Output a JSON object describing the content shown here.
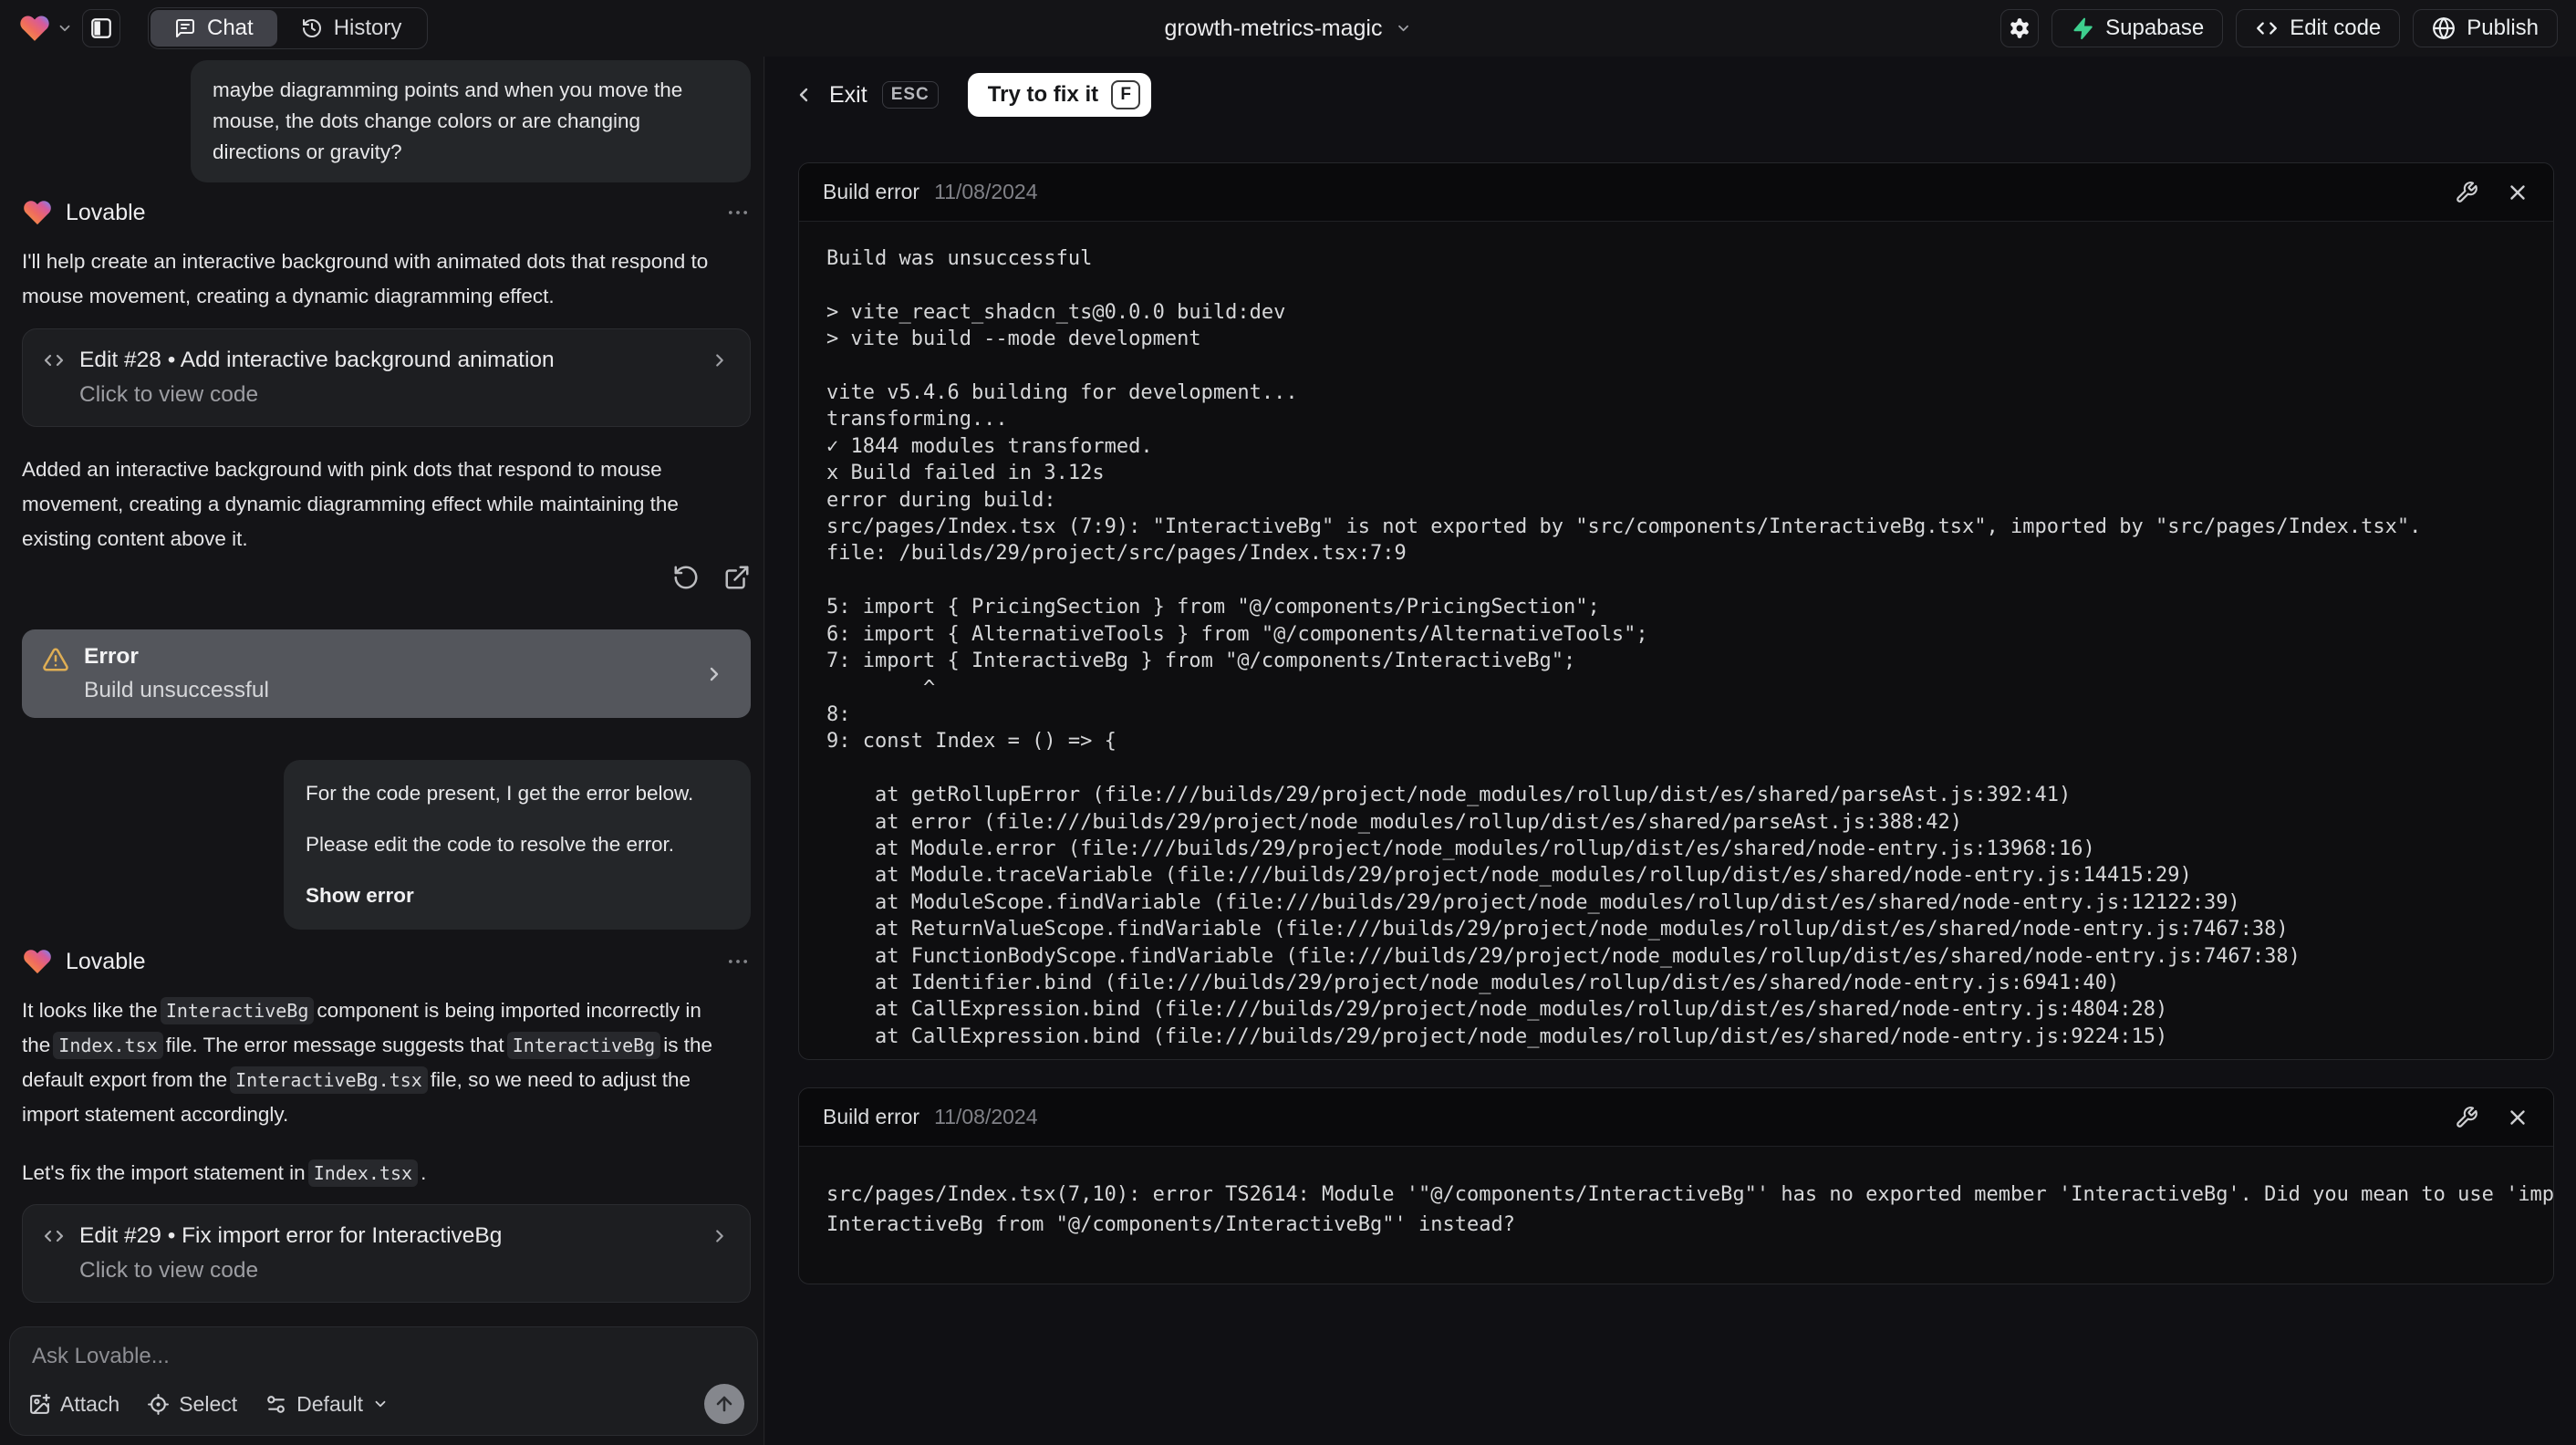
{
  "topbar": {
    "project_name": "growth-metrics-magic",
    "tab_chat": "Chat",
    "tab_history": "History",
    "supabase_label": "Supabase",
    "edit_code_label": "Edit code",
    "publish_label": "Publish"
  },
  "icons": {
    "logo": "lovable-heart-icon",
    "accent_green": "#3ecf8e",
    "warning_color": "#dfae54"
  },
  "chat": {
    "sender": "Lovable",
    "user_msg1": "maybe diagramming points and when you move the mouse, the dots change colors or are changing directions or gravity?",
    "assistant1": {
      "intro": "I'll help create an interactive background with animated dots that respond to mouse movement, creating a dynamic diagramming effect.",
      "edit_card": {
        "title": "Edit #28 • Add interactive background animation",
        "subtitle": "Click to view code"
      },
      "summary": "Added an interactive background with pink dots that respond to mouse movement, creating a dynamic diagramming effect while maintaining the existing content above it.",
      "error_card": {
        "title": "Error",
        "subtitle": "Build unsuccessful"
      }
    },
    "user_msg2": {
      "line1": "For the code present, I get the error below.",
      "line2": "Please edit the code to resolve the error.",
      "action": "Show error"
    },
    "assistant2": {
      "p1": [
        "It looks like the",
        "InteractiveBg",
        "component is being imported incorrectly in the",
        "Index.tsx",
        "file. The error message suggests that",
        "InteractiveBg",
        "is the default export from the",
        "InteractiveBg.tsx",
        "file, so we need to adjust the import statement accordingly."
      ],
      "p2": [
        "Let's fix the import statement in",
        "Index.tsx",
        "."
      ],
      "edit_card": {
        "title": "Edit #29 • Fix import error for InteractiveBg",
        "subtitle": "Click to view code"
      }
    },
    "composer": {
      "placeholder": "Ask Lovable...",
      "attach": "Attach",
      "select": "Select",
      "mode": "Default"
    }
  },
  "error_panel": {
    "exit_label": "Exit",
    "esc_key": "ESC",
    "fix_label": "Try to fix it",
    "fix_key": "F",
    "card1": {
      "title": "Build error",
      "date": "11/08/2024",
      "lines": [
        "Build was unsuccessful",
        "",
        "> vite_react_shadcn_ts@0.0.0 build:dev",
        "> vite build --mode development",
        "",
        "vite v5.4.6 building for development...",
        "transforming...",
        "✓ 1844 modules transformed.",
        "x Build failed in 3.12s",
        "error during build:",
        "src/pages/Index.tsx (7:9): \"InteractiveBg\" is not exported by \"src/components/InteractiveBg.tsx\", imported by \"src/pages/Index.tsx\".",
        "file: /builds/29/project/src/pages/Index.tsx:7:9",
        "",
        "5: import { PricingSection } from \"@/components/PricingSection\";",
        "6: import { AlternativeTools } from \"@/components/AlternativeTools\";",
        "7: import { InteractiveBg } from \"@/components/InteractiveBg\";",
        "        ^",
        "8: ",
        "9: const Index = () => {",
        "",
        "    at getRollupError (file:///builds/29/project/node_modules/rollup/dist/es/shared/parseAst.js:392:41)",
        "    at error (file:///builds/29/project/node_modules/rollup/dist/es/shared/parseAst.js:388:42)",
        "    at Module.error (file:///builds/29/project/node_modules/rollup/dist/es/shared/node-entry.js:13968:16)",
        "    at Module.traceVariable (file:///builds/29/project/node_modules/rollup/dist/es/shared/node-entry.js:14415:29)",
        "    at ModuleScope.findVariable (file:///builds/29/project/node_modules/rollup/dist/es/shared/node-entry.js:12122:39)",
        "    at ReturnValueScope.findVariable (file:///builds/29/project/node_modules/rollup/dist/es/shared/node-entry.js:7467:38)",
        "    at FunctionBodyScope.findVariable (file:///builds/29/project/node_modules/rollup/dist/es/shared/node-entry.js:7467:38)",
        "    at Identifier.bind (file:///builds/29/project/node_modules/rollup/dist/es/shared/node-entry.js:6941:40)",
        "    at CallExpression.bind (file:///builds/29/project/node_modules/rollup/dist/es/shared/node-entry.js:4804:28)",
        "    at CallExpression.bind (file:///builds/29/project/node_modules/rollup/dist/es/shared/node-entry.js:9224:15)"
      ]
    },
    "card2": {
      "title": "Build error",
      "date": "11/08/2024",
      "lines": [
        "src/pages/Index.tsx(7,10): error TS2614: Module '\"@/components/InteractiveBg\"' has no exported member 'InteractiveBg'. Did you mean to use 'import",
        "InteractiveBg from \"@/components/InteractiveBg\"' instead?"
      ]
    }
  }
}
